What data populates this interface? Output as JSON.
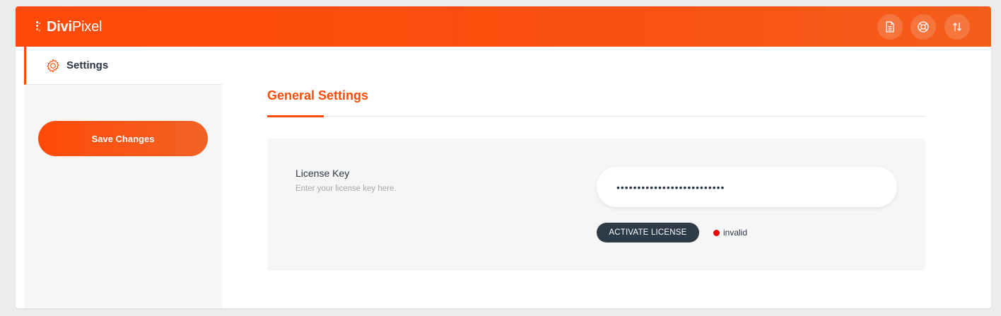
{
  "header": {
    "logo_bold": "Divi",
    "logo_light": "Pixel",
    "buttons": [
      {
        "name": "documentation-icon"
      },
      {
        "name": "support-icon"
      },
      {
        "name": "import-export-icon"
      }
    ]
  },
  "sidebar": {
    "tab_label": "Settings",
    "tab_icon": "gear-icon",
    "save_label": "Save Changes"
  },
  "main": {
    "section_title": "General Settings",
    "license": {
      "label": "License Key",
      "hint": "Enter your license key here.",
      "value": "••••••••••••••••••••••••••",
      "activate_label": "ACTIVATE LICENSE",
      "status_text": "invalid",
      "status_color": "#ee0000"
    }
  },
  "colors": {
    "accent": "#ff4a08",
    "dark": "#2d3b48"
  }
}
